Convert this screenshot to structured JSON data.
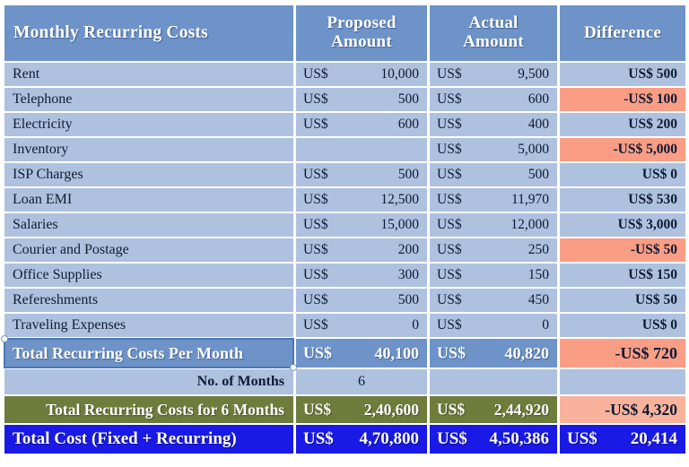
{
  "table": {
    "headers": {
      "label": "Monthly Recurring Costs",
      "proposed_l1": "Proposed",
      "proposed_l2": "Amount",
      "actual_l1": "Actual",
      "actual_l2": "Amount",
      "difference": "Difference"
    },
    "currency": "US$",
    "rows": [
      {
        "label": "Rent",
        "proposed": "10,000",
        "proposed_cur": "US$",
        "actual": "9,500",
        "actual_cur": "US$",
        "difference": "US$ 500",
        "negative": false
      },
      {
        "label": "Telephone",
        "proposed": "500",
        "proposed_cur": "US$",
        "actual": "600",
        "actual_cur": "US$",
        "difference": "-US$ 100",
        "negative": true
      },
      {
        "label": "Electricity",
        "proposed": "600",
        "proposed_cur": "US$",
        "actual": "400",
        "actual_cur": "US$",
        "difference": "US$ 200",
        "negative": false
      },
      {
        "label": "Inventory",
        "proposed": "",
        "proposed_cur": "",
        "actual": "5,000",
        "actual_cur": "US$",
        "difference": "-US$ 5,000",
        "negative": true
      },
      {
        "label": "ISP Charges",
        "proposed": "500",
        "proposed_cur": "US$",
        "actual": "500",
        "actual_cur": "US$",
        "difference": "US$ 0",
        "negative": false
      },
      {
        "label": "Loan EMI",
        "proposed": "12,500",
        "proposed_cur": "US$",
        "actual": "11,970",
        "actual_cur": "US$",
        "difference": "US$ 530",
        "negative": false
      },
      {
        "label": "Salaries",
        "proposed": "15,000",
        "proposed_cur": "US$",
        "actual": "12,000",
        "actual_cur": "US$",
        "difference": "US$ 3,000",
        "negative": false
      },
      {
        "label": "Courier and Postage",
        "proposed": "200",
        "proposed_cur": "US$",
        "actual": "250",
        "actual_cur": "US$",
        "difference": "-US$ 50",
        "negative": true
      },
      {
        "label": "Office Supplies",
        "proposed": "300",
        "proposed_cur": "US$",
        "actual": "150",
        "actual_cur": "US$",
        "difference": "US$ 150",
        "negative": false
      },
      {
        "label": "Refereshments",
        "proposed": "500",
        "proposed_cur": "US$",
        "actual": "450",
        "actual_cur": "US$",
        "difference": "US$ 50",
        "negative": false
      },
      {
        "label": "Traveling Expenses",
        "proposed": "0",
        "proposed_cur": "US$",
        "actual": "0",
        "actual_cur": "US$",
        "difference": "US$ 0",
        "negative": false
      }
    ],
    "total_month": {
      "label": "Total Recurring Costs Per Month",
      "proposed_cur": "US$",
      "proposed": "40,100",
      "actual_cur": "US$",
      "actual": "40,820",
      "difference": "-US$ 720"
    },
    "months": {
      "label": "No. of Months",
      "value": "6"
    },
    "total_period": {
      "label": "Total Recurring Costs for 6 Months",
      "proposed_cur": "US$",
      "proposed": "2,40,600",
      "actual_cur": "US$",
      "actual": "2,44,920",
      "difference": "-US$ 4,320"
    },
    "grand_total": {
      "label": "Total Cost (Fixed + Recurring)",
      "proposed_cur": "US$",
      "proposed": "4,70,800",
      "actual_cur": "US$",
      "actual": "4,50,386",
      "difference_cur": "US$",
      "difference": "20,414"
    }
  },
  "colors": {
    "header_blue": "#6e93c8",
    "cell_blue": "#aec1df",
    "negative_salmon": "#fa9d85",
    "olive": "#6e7c3c",
    "grand_blue": "#1a1ae6"
  }
}
